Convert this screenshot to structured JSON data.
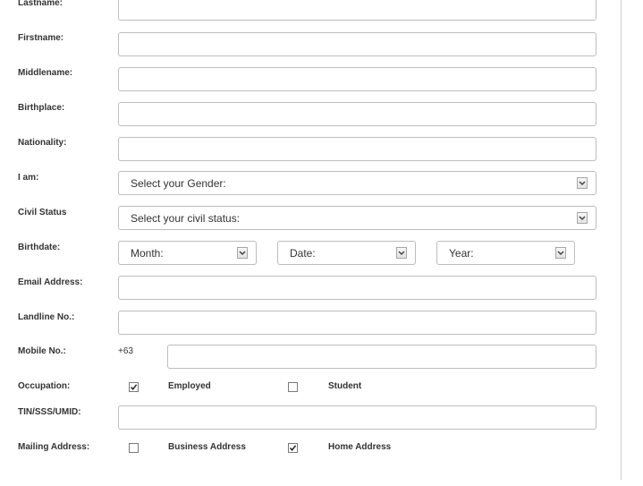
{
  "form": {
    "lastname": {
      "label": "Lastname:",
      "value": ""
    },
    "firstname": {
      "label": "Firstname:",
      "value": ""
    },
    "middlename": {
      "label": "Middlename:",
      "value": ""
    },
    "birthplace": {
      "label": "Birthplace:",
      "value": ""
    },
    "nationality": {
      "label": "Nationality:",
      "value": ""
    },
    "gender": {
      "label": "I am:",
      "selected": "Select your Gender:"
    },
    "civil_status": {
      "label": "Civil Status",
      "selected": "Select your civil status:"
    },
    "birthdate": {
      "label": "Birthdate:",
      "month": "Month:",
      "date": "Date:",
      "year": "Year:"
    },
    "email": {
      "label": "Email Address:",
      "value": ""
    },
    "landline": {
      "label": "Landline No.:",
      "value": ""
    },
    "mobile": {
      "label": "Mobile No.:",
      "prefix": "+63",
      "value": ""
    },
    "occupation": {
      "label": "Occupation:",
      "options": [
        {
          "label": "Employed",
          "checked": true
        },
        {
          "label": "Student",
          "checked": false
        }
      ]
    },
    "tin": {
      "label": "TIN/SSS/UMID:",
      "value": ""
    },
    "mailing_address": {
      "label": "Mailing Address:",
      "options": [
        {
          "label": "Business Address",
          "checked": false
        },
        {
          "label": "Home Address",
          "checked": true
        }
      ]
    }
  },
  "icons": {
    "dropdown": "chevron-down-icon",
    "check": "checkmark-icon"
  }
}
